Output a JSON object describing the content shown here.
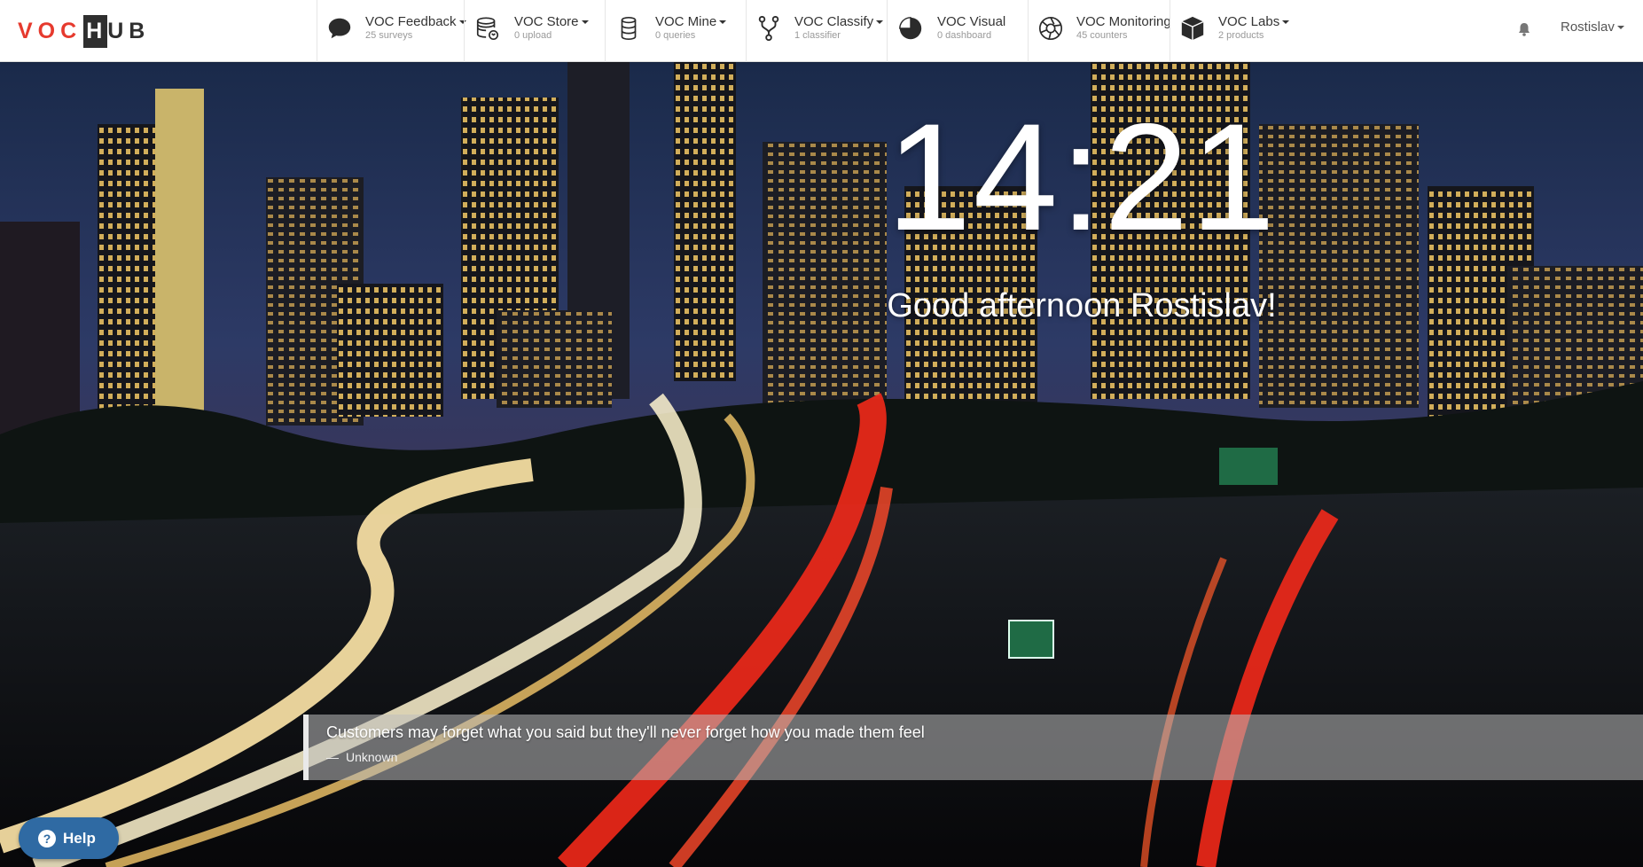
{
  "logo": {
    "part1": "VOC",
    "part2": "H",
    "part3": "UB"
  },
  "menu": [
    {
      "title": "VOC Feedback",
      "sub": "25 surveys",
      "has_caret": true,
      "icon": "chat-bubble-icon"
    },
    {
      "title": "VOC Store",
      "sub": "0 upload",
      "has_caret": true,
      "icon": "database-sync-icon"
    },
    {
      "title": "VOC Mine",
      "sub": "0 queries",
      "has_caret": true,
      "icon": "database-icon"
    },
    {
      "title": "VOC Classify",
      "sub": "1 classifier",
      "has_caret": true,
      "icon": "fork-icon"
    },
    {
      "title": "VOC Visual",
      "sub": "0 dashboard",
      "has_caret": false,
      "icon": "pie-chart-icon"
    },
    {
      "title": "VOC Monitoring",
      "sub": "45 counters",
      "has_caret": false,
      "icon": "aperture-icon"
    },
    {
      "title": "VOC Labs",
      "sub": "2 products",
      "has_caret": true,
      "icon": "cube-icon"
    }
  ],
  "user": {
    "name": "Rostislav"
  },
  "clock": {
    "time": "14:21"
  },
  "greeting": "Good afternoon Rostislav!",
  "quote": {
    "text": "Customers may forget what you said but they'll never forget how you made them feel",
    "dash": "—",
    "author": "Unknown"
  },
  "help": {
    "label": "Help",
    "icon_glyph": "?"
  },
  "colors": {
    "logo_red": "#e63a2e",
    "logo_dark": "#2f2f2f",
    "help_blue": "#2f6aa3"
  }
}
